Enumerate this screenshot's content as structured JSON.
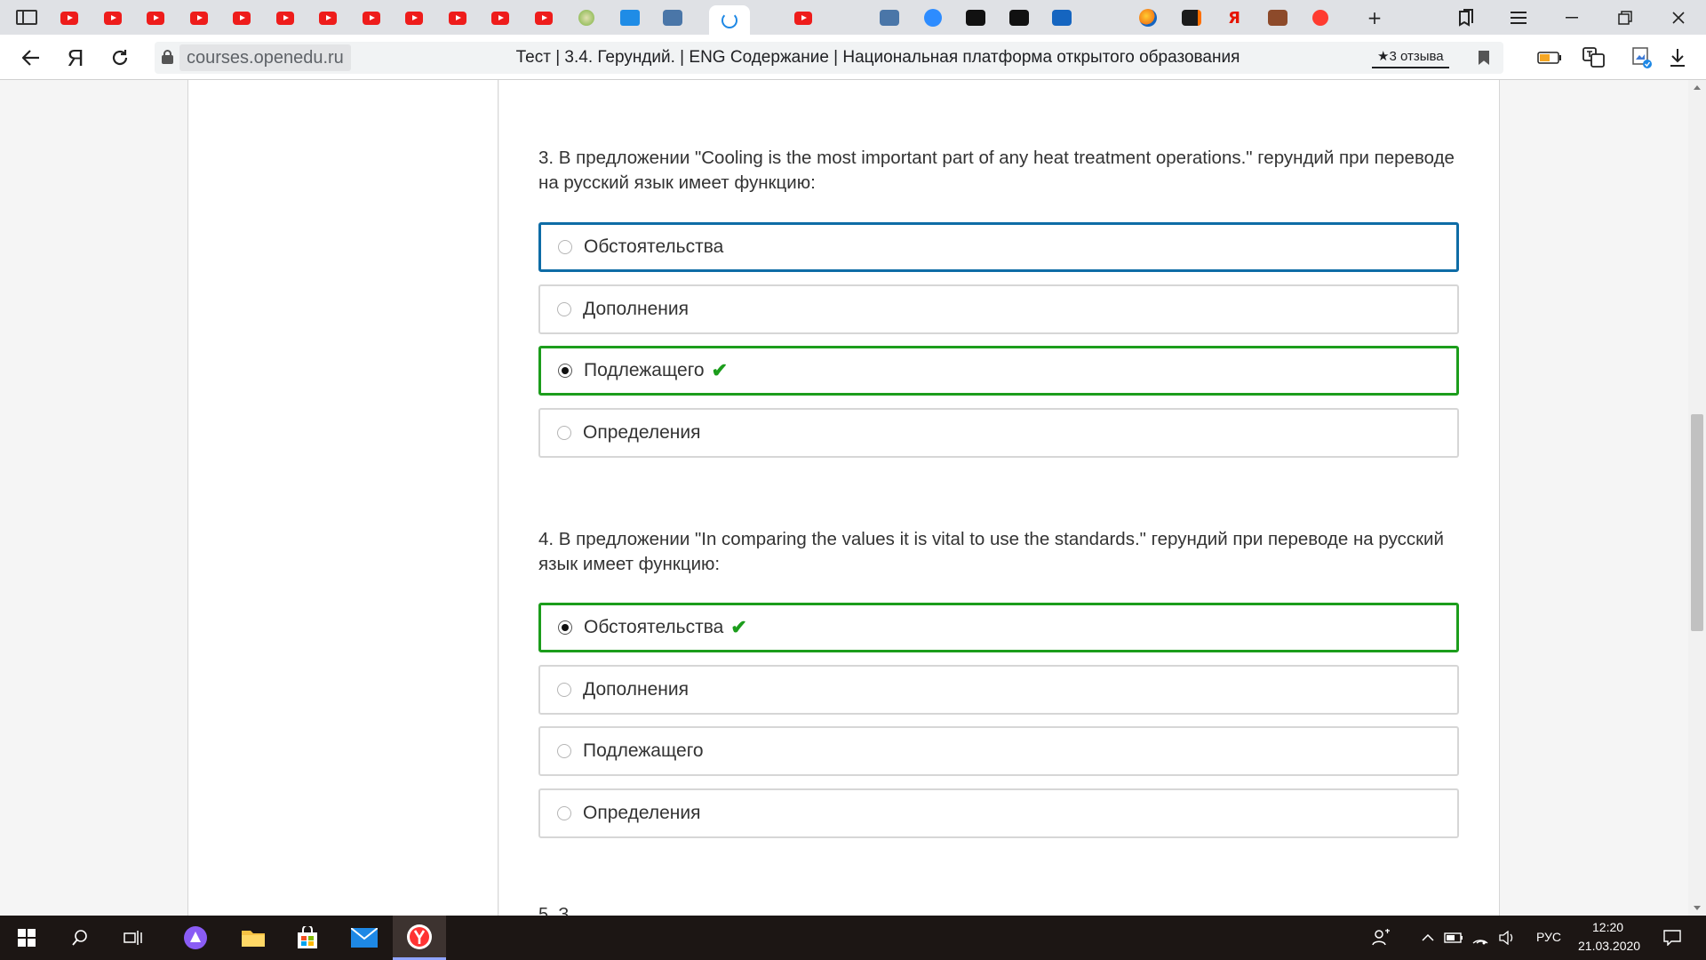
{
  "browser": {
    "tabs": [
      {
        "icon": "youtube-icon"
      },
      {
        "icon": "youtube-icon"
      },
      {
        "icon": "youtube-icon"
      },
      {
        "icon": "youtube-icon"
      },
      {
        "icon": "youtube-icon"
      },
      {
        "icon": "youtube-icon"
      },
      {
        "icon": "youtube-icon"
      },
      {
        "icon": "youtube-icon"
      },
      {
        "icon": "youtube-icon"
      },
      {
        "icon": "youtube-icon"
      },
      {
        "icon": "youtube-icon"
      },
      {
        "icon": "youtube-icon"
      },
      {
        "icon": "satellite-icon"
      },
      {
        "icon": "chat-icon"
      },
      {
        "icon": "vk-icon"
      },
      {
        "icon": "loading-spinner-icon",
        "active": true
      },
      {
        "icon": "academic-hat-icon"
      },
      {
        "icon": "youtube-icon"
      },
      {
        "icon": "academic-hat-icon"
      },
      {
        "icon": "vk-icon"
      },
      {
        "icon": "zoom-icon"
      },
      {
        "icon": "chart-icon"
      },
      {
        "icon": "chart-icon"
      },
      {
        "icon": "blue-book-icon"
      },
      {
        "icon": "academic-hat-icon"
      },
      {
        "icon": "orb-icon"
      },
      {
        "icon": "mail-icon"
      },
      {
        "icon": "yandex-icon"
      },
      {
        "icon": "book-icon"
      },
      {
        "icon": "record-icon"
      }
    ],
    "yandex_letter": "Я",
    "address": {
      "domain": "courses.openedu.ru",
      "page_title": "Тест | 3.4. Герундий. | ENG Содержание | Национальная платформа открытого образования",
      "reviews": "★3 отзыва"
    },
    "colors": {
      "accent": "#0e6ca6",
      "correct": "#1c9d1c",
      "youtube": "#ee1c1b"
    }
  },
  "quiz": {
    "questions": [
      {
        "text": "3. В предложении \"Cooling is the most important part of any heat treatment operations.\" герундий при переводе на русский язык имеет функцию:",
        "options": [
          {
            "label": "Обстоятельства",
            "state": "focused",
            "checked": false
          },
          {
            "label": "Дополнения",
            "state": "default",
            "checked": false
          },
          {
            "label": "Подлежащего",
            "state": "correct",
            "checked": true
          },
          {
            "label": "Определения",
            "state": "default",
            "checked": false
          }
        ]
      },
      {
        "text": "4. В предложении \"In comparing the values it is vital to use the standards.\" герундий при переводе на русский язык имеет функцию:",
        "options": [
          {
            "label": "Обстоятельства",
            "state": "correct",
            "checked": true
          },
          {
            "label": "Дополнения",
            "state": "default",
            "checked": false
          },
          {
            "label": "Подлежащего",
            "state": "default",
            "checked": false
          },
          {
            "label": "Определения",
            "state": "default",
            "checked": false
          }
        ]
      }
    ],
    "check_mark": "✔",
    "next_peek": "5. З"
  },
  "taskbar": {
    "language": "РУС",
    "time": "12:20",
    "date": "21.03.2020"
  }
}
